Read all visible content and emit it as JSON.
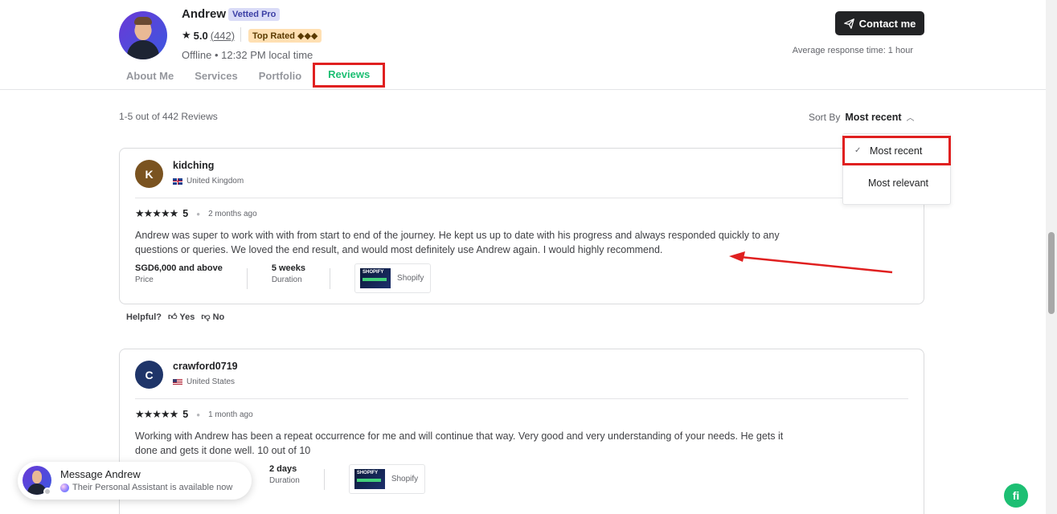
{
  "profile": {
    "name": "Andrew",
    "vetted_badge": "Vetted Pro",
    "rating": "5.0",
    "rating_count": "(442)",
    "top_rated_badge": "Top Rated ◆◆◆",
    "status": "Offline • 12:32 PM local time",
    "contact_button": "Contact me",
    "response_time": "Average response time: 1 hour"
  },
  "tabs": [
    {
      "label": "About Me"
    },
    {
      "label": "Services"
    },
    {
      "label": "Portfolio"
    },
    {
      "label": "Reviews"
    }
  ],
  "reviews_header": {
    "count_label": "1-5 out of 442 Reviews",
    "sort_prefix": "Sort By",
    "sort_value": "Most recent"
  },
  "sort_options": [
    {
      "label": "Most recent",
      "selected": true
    },
    {
      "label": "Most relevant",
      "selected": false
    }
  ],
  "reviews": [
    {
      "initial": "K",
      "avatar_color": "#7a5320",
      "username": "kidching",
      "country": "United Kingdom",
      "stars": "★★★★★",
      "score": "5",
      "time_ago": "2 months ago",
      "text": "Andrew was super to work with with from start to end of the journey. He kept us up to date with his progress and always responded quickly to any questions or queries. We loved the end result, and would most definitely use Andrew again. I would highly recommend.",
      "price": "SGD6,000 and above",
      "price_label": "Price",
      "duration": "5 weeks",
      "duration_label": "Duration",
      "service": "Shopify"
    },
    {
      "initial": "C",
      "avatar_color": "#1f3569",
      "username": "crawford0719",
      "country": "United States",
      "stars": "★★★★★",
      "score": "5",
      "time_ago": "1 month ago",
      "text": "Working with Andrew has been a repeat occurrence for me and will continue that way. Very good and very understanding of your needs. He gets it done and gets it done well. 10 out of 10",
      "duration": "2 days",
      "duration_label": "Duration",
      "service": "Shopify"
    }
  ],
  "helpful": {
    "label": "Helpful?",
    "yes": "Yes",
    "no": "No"
  },
  "message_widget": {
    "title": "Message Andrew",
    "subtitle": "Their Personal Assistant is available now"
  },
  "fiverr_button": "fi",
  "colors": {
    "accent_green": "#1dbf73",
    "annotation_red": "#e02020"
  }
}
